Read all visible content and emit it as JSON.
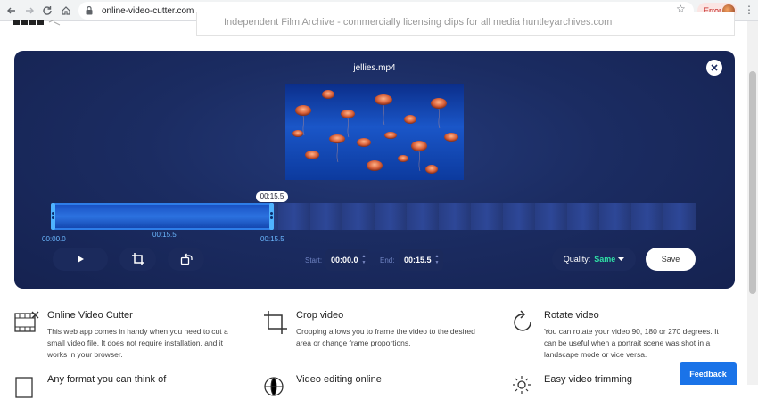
{
  "browser": {
    "url": "online-video-cutter.com",
    "error_label": "Error",
    "icons": [
      "back-icon",
      "forward-icon",
      "reload-icon",
      "lock-icon",
      "star-icon",
      "avatar",
      "menu-dots-icon"
    ]
  },
  "ad": {
    "text": "Independent Film Archive - commercially licensing clips for all media huntleyarchives.com"
  },
  "editor": {
    "file_name": "jellies.mp4",
    "timeline": {
      "bubble_time": "00:15.5",
      "start_label": "00:00.0",
      "mid_label": "00:15.5",
      "end_label": "00:15.5",
      "selection_fraction": 0.34
    },
    "controls": {
      "start_label": "Start:",
      "start_value": "00:00.0",
      "end_label": "End:",
      "end_value": "00:15.5",
      "quality_label": "Quality:",
      "quality_value": "Same",
      "save_label": "Save"
    },
    "colors": {
      "panel": "#1b2c62",
      "accent": "#2e7de8",
      "quality_value": "#2fe0a6"
    }
  },
  "features": [
    {
      "title": "Online Video Cutter",
      "desc": "This web app comes in handy when you need to cut a small video file. It does not require installation, and it works in your browser.",
      "icon": "film-cut-icon"
    },
    {
      "title": "Crop video",
      "desc": "Cropping allows you to frame the video to the desired area or change frame proportions.",
      "icon": "crop-icon"
    },
    {
      "title": "Rotate video",
      "desc": "You can rotate your video 90, 180 or 270 degrees. It can be useful when a portrait scene was shot in a landscape mode or vice versa.",
      "icon": "rotate-icon"
    },
    {
      "title": "Any format you can think of",
      "icon": "formats-icon"
    },
    {
      "title": "Video editing online",
      "icon": "globe-icon"
    },
    {
      "title": "Easy video trimming",
      "icon": "sun-icon"
    }
  ],
  "feedback_label": "Feedback"
}
